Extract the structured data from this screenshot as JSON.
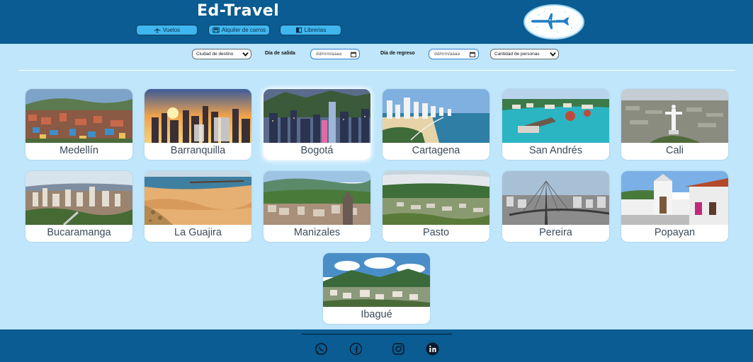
{
  "header": {
    "brand": "Ed-Travel",
    "nav": [
      {
        "label": "Vuelos",
        "icon": "airplane-icon"
      },
      {
        "label": "Alquiler de carros",
        "icon": "car-icon"
      },
      {
        "label": "Librerias",
        "icon": "book-icon"
      }
    ],
    "logo_icon": "airplane-logo-icon"
  },
  "filters": {
    "destination": "Ciudad de destino",
    "departure_label": "Día de salida",
    "departure_value": "dd/mm/aaaa",
    "return_label": "Día de regreso",
    "return_value": "dd/mm/aaaa",
    "people": "Cantidad de personas"
  },
  "cities": [
    "Medellín",
    "Barranquilla",
    "Bogotá",
    "Cartagena",
    "San Andrés",
    "Cali",
    "Bucaramanga",
    "La Guajira",
    "Manizales",
    "Pasto",
    "Pereira",
    "Popayan",
    "Ibagué"
  ],
  "footer": {
    "social": [
      "whatsapp-icon",
      "facebook-icon",
      "instagram-icon",
      "linkedin-icon"
    ]
  },
  "colors": {
    "header": "#0a5c92",
    "page_bg": "#bfe6fb",
    "nav_button": "#3fb6ee",
    "card_text": "#3b4b5a"
  }
}
